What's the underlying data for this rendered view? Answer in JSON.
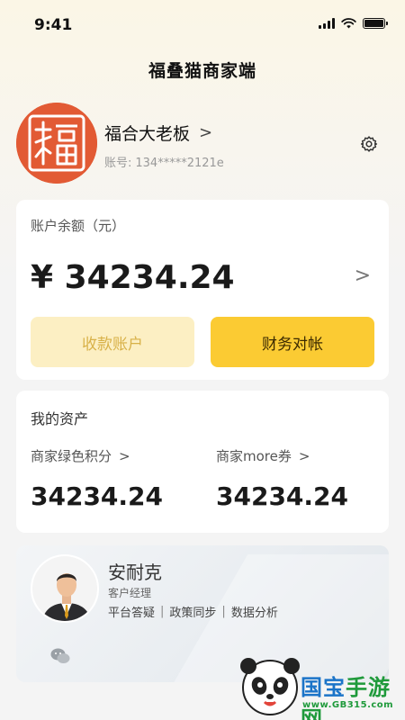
{
  "status_bar": {
    "time": "9:41"
  },
  "nav": {
    "title": "福叠猫商家端"
  },
  "profile": {
    "avatar_char": "福",
    "name": "福合大老板",
    "chevron": ">",
    "account_label": "账号:",
    "account_value": "134*****2121e"
  },
  "balance": {
    "label": "账户余额（元）",
    "value": "¥ 34234.24",
    "chevron": ">",
    "button_receive": "收款账户",
    "button_reconcile": "财务对帐"
  },
  "assets": {
    "title": "我的资产",
    "items": [
      {
        "label": "商家绿色积分",
        "chevron": ">",
        "value": "34234.24"
      },
      {
        "label": "商家more券",
        "chevron": ">",
        "value": "34234.24"
      }
    ]
  },
  "manager": {
    "name": "安耐克",
    "role": "客户经理",
    "tags": [
      "平台答疑",
      "政策同步",
      "数据分析"
    ],
    "separator": "|"
  },
  "watermark": {
    "brand_part1": "国宝",
    "brand_part2": "手游网",
    "url": "www.GB315.com"
  },
  "colors": {
    "accent_yellow": "#fbcb33",
    "light_yellow": "#fcefc3",
    "avatar_orange": "#e25a34",
    "watermark_green": "#1f9a3b"
  },
  "icons": [
    "signal-icon",
    "wifi-icon",
    "battery-icon",
    "gear-icon",
    "chevron-right-icon",
    "wechat-icon",
    "panda-logo-icon"
  ]
}
